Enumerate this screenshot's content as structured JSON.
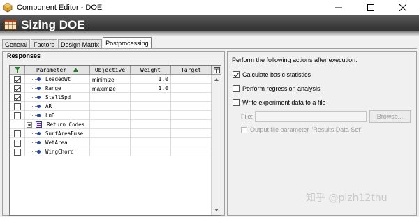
{
  "window": {
    "title": "Component Editor - DOE",
    "controls": {
      "minimize": "—",
      "maximize": "☐",
      "close": "✕"
    }
  },
  "banner": {
    "title": "Sizing DOE",
    "icon": "doe-grid-icon"
  },
  "tabs": [
    {
      "label": "General",
      "active": false
    },
    {
      "label": "Factors",
      "active": false
    },
    {
      "label": "Design Matrix",
      "active": false
    },
    {
      "label": "Postprocessing",
      "active": true
    }
  ],
  "responses": {
    "title": "Responses",
    "headers": {
      "parameter": "Parameter",
      "objective": "Objective",
      "weight": "Weight",
      "target": "Target"
    },
    "rows": [
      {
        "checked": true,
        "name": "LoadedWt",
        "objective": "minimize",
        "weight": "1.0",
        "target": ""
      },
      {
        "checked": true,
        "name": "Range",
        "objective": "maximize",
        "weight": "1.0",
        "target": ""
      },
      {
        "checked": true,
        "name": "StallSpd",
        "objective": "",
        "weight": "",
        "target": ""
      },
      {
        "checked": false,
        "name": "AR",
        "objective": "",
        "weight": "",
        "target": ""
      },
      {
        "checked": false,
        "name": "LoD",
        "objective": "",
        "weight": "",
        "target": ""
      },
      {
        "checked": null,
        "name": "Return Codes",
        "objective": "",
        "weight": "",
        "target": ""
      },
      {
        "checked": false,
        "name": "SurfAreaFuse",
        "objective": "",
        "weight": "",
        "target": ""
      },
      {
        "checked": false,
        "name": "WetArea",
        "objective": "",
        "weight": "",
        "target": ""
      },
      {
        "checked": false,
        "name": "WingChord",
        "objective": "",
        "weight": "",
        "target": ""
      }
    ]
  },
  "actions": {
    "heading": "Perform the following actions after execution:",
    "calc_stats": {
      "label": "Calculate basic statistics",
      "checked": true
    },
    "regression": {
      "label": "Perform regression analysis",
      "checked": false
    },
    "write_file": {
      "label": "Write experiment data to a file",
      "checked": false
    },
    "file_label": "File:",
    "file_value": "",
    "browse_label": "Browse...",
    "output_param": {
      "label": "Output file parameter \"Results.Data Set\"",
      "checked": false
    }
  },
  "watermark": "知乎 @pizh12thu"
}
